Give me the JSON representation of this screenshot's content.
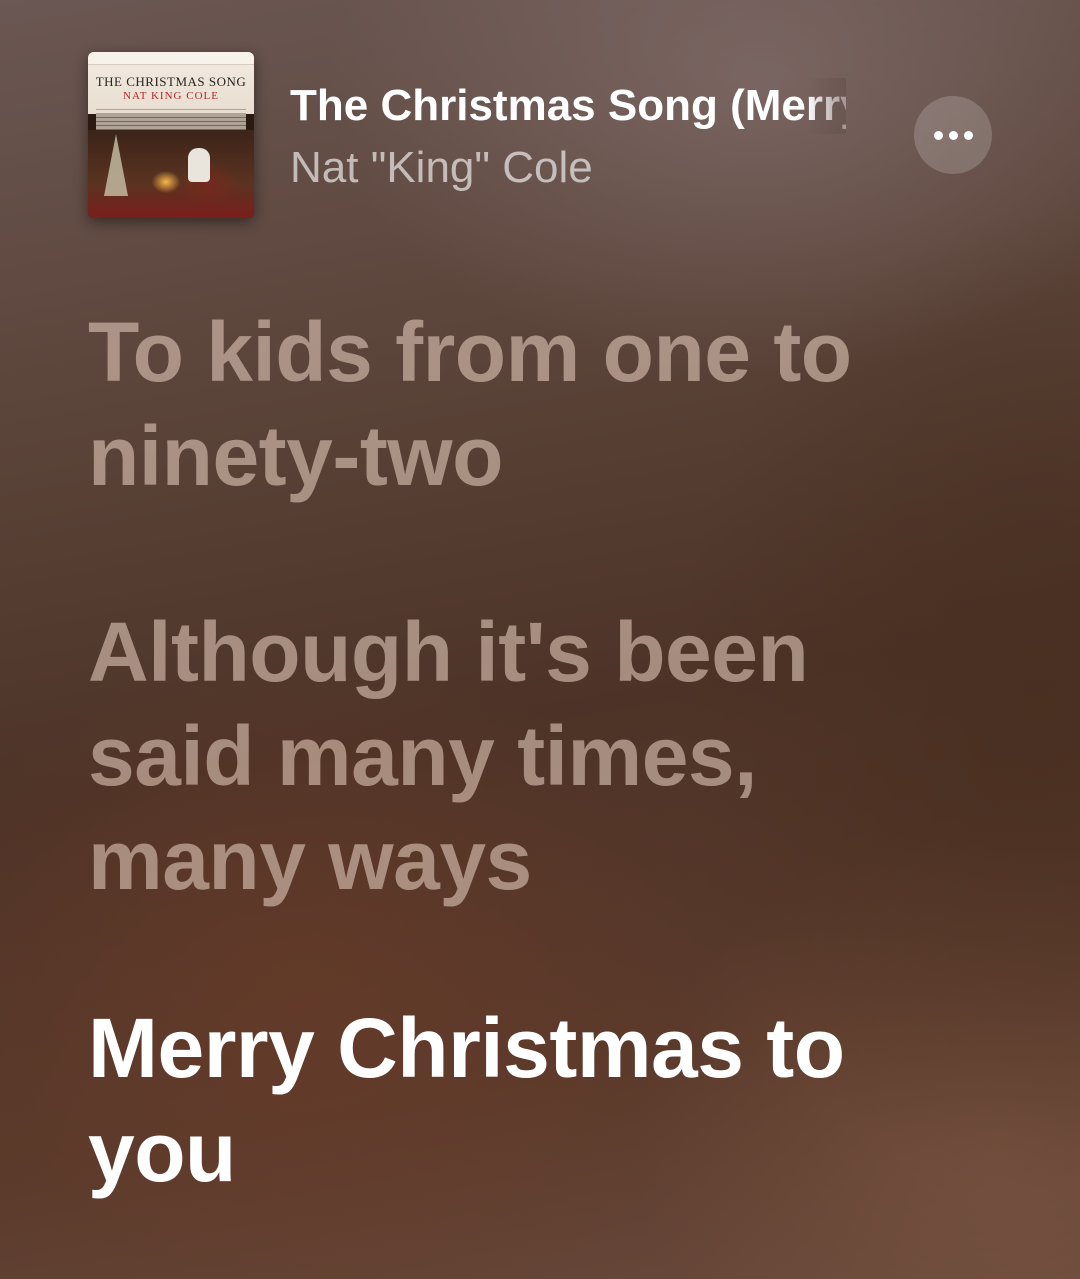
{
  "now_playing": {
    "artwork": {
      "title": "The Christmas Song",
      "artist": "Nat King Cole"
    },
    "title": "The Christmas Song (Merry Christmas To You)",
    "artist": "Nat \"King\" Cole",
    "more_button_icon": "ellipsis-icon"
  },
  "lyrics": {
    "lines": [
      {
        "text": "To kids from one to ninety-two",
        "state": "past"
      },
      {
        "text": "Although it's been said many times, many ways",
        "state": "past"
      },
      {
        "text": "Merry Christmas to you",
        "state": "current"
      }
    ]
  },
  "colors": {
    "current_lyric": "#ffffff",
    "past_lyric": "#dcc3b4"
  }
}
